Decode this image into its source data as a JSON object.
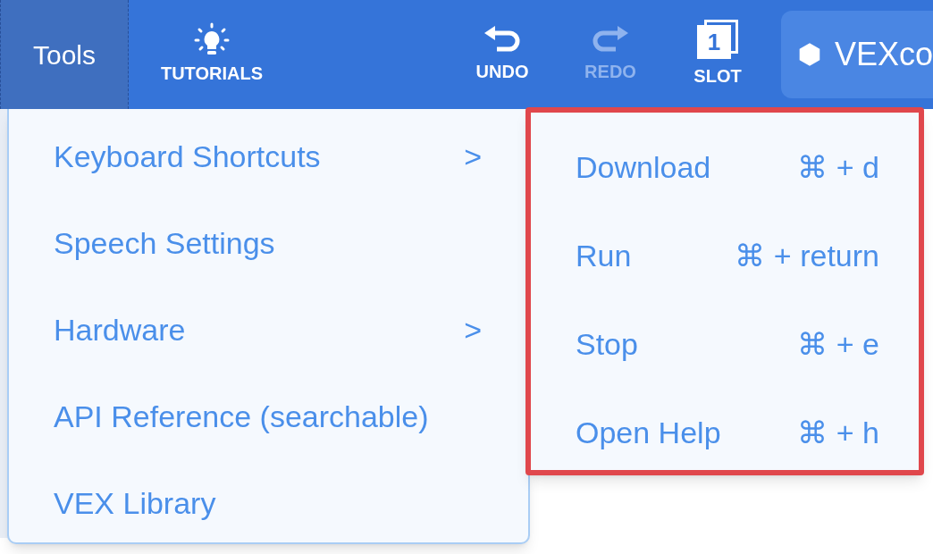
{
  "toolbar": {
    "tools_menu": {
      "label": "Tools",
      "open": true
    },
    "buttons": [
      {
        "kind": "tutorials",
        "label": "TUTORIALS",
        "disabled": false
      },
      {
        "kind": "undo",
        "label": "UNDO",
        "disabled": false
      },
      {
        "kind": "redo",
        "label": "REDO",
        "disabled": true
      },
      {
        "kind": "slot",
        "label": "SLOT",
        "slot_number": "1",
        "disabled": false
      }
    ],
    "project_title": "VEXco"
  },
  "menu": {
    "items": [
      {
        "label": "Keyboard Shortcuts",
        "submenu_arrow": ">"
      },
      {
        "label": "Speech Settings"
      },
      {
        "label": "Hardware",
        "submenu_arrow": ">"
      },
      {
        "label": "API Reference (searchable)"
      },
      {
        "label": "VEX Library"
      }
    ]
  },
  "submenu": {
    "highlighted": true,
    "items": [
      {
        "label": "Download",
        "shortcut": "⌘ + d"
      },
      {
        "label": "Run",
        "shortcut": "⌘ + return"
      },
      {
        "label": "Stop",
        "shortcut": "⌘ + e"
      },
      {
        "label": "Open Help",
        "shortcut": "⌘ + h"
      }
    ]
  }
}
